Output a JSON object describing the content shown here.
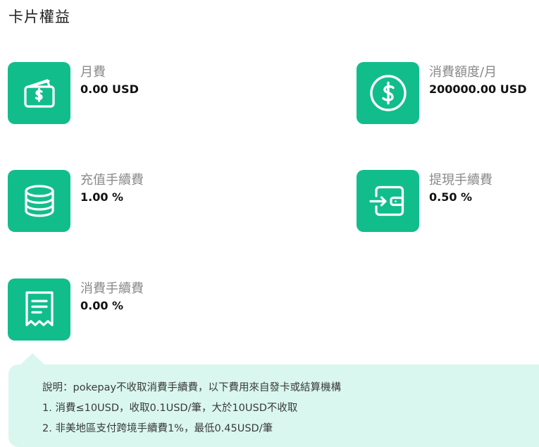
{
  "page": {
    "title": "卡片權益"
  },
  "benefits": [
    {
      "icon": "wallet-dollar-icon",
      "label": "月費",
      "value": "0.00 USD"
    },
    {
      "icon": "dollar-circle-icon",
      "label": "消費額度/月",
      "value": "200000.00 USD"
    },
    {
      "icon": "coin-stack-icon",
      "label": "充值手續費",
      "value": "1.00 %"
    },
    {
      "icon": "wallet-withdraw-icon",
      "label": "提現手續費",
      "value": "0.50 %"
    },
    {
      "icon": "receipt-icon",
      "label": "消費手續費",
      "value": "0.00 %"
    }
  ],
  "note": {
    "lines": [
      "說明：pokepay不收取消費手續費，以下費用來自發卡或結算機構",
      "1. 消費≤10USD，收取0.1USD/筆，大於10USD不收取",
      "2. 非美地區支付跨境手續費1%，最低0.45USD/筆"
    ]
  },
  "colors": {
    "accent": "#12bd8c",
    "note_background": "#d9f7ee",
    "label_gray": "#8a8a8a"
  }
}
